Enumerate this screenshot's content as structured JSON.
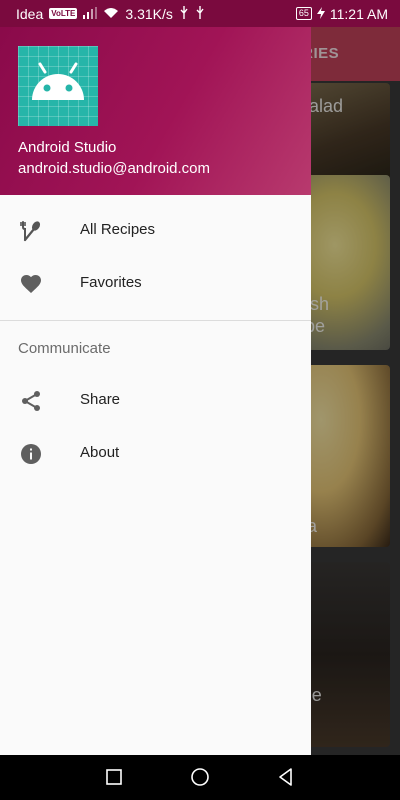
{
  "status_bar": {
    "carrier": "Idea",
    "volte": "VoLTE",
    "speed": "3.31K/s",
    "battery": "65",
    "time": "11:21 AM"
  },
  "background_app": {
    "toolbar_tab": "ORIES",
    "cards": [
      {
        "title": "b Salad\npe"
      },
      {
        "title": "a Ilish\necipe"
      },
      {
        "title": "apta"
      },
      {
        "title": "offee\npe"
      }
    ]
  },
  "drawer": {
    "header": {
      "name": "Android Studio",
      "email": "android.studio@android.com",
      "icon": "android-icon"
    },
    "items": [
      {
        "label": "All Recipes",
        "icon": "fork-spoon-icon"
      },
      {
        "label": "Favorites",
        "icon": "heart-icon"
      }
    ],
    "section_header": "Communicate",
    "section_items": [
      {
        "label": "Share",
        "icon": "share-icon"
      },
      {
        "label": "About",
        "icon": "info-icon"
      }
    ]
  },
  "nav_bar": {
    "buttons": [
      "recents-icon",
      "home-icon",
      "back-icon"
    ]
  },
  "colors": {
    "header_primary": "#a11456",
    "status_bar": "#7a0a3e",
    "toolbar_behind": "#c2425a",
    "icon_teal": "#26b5a9"
  }
}
